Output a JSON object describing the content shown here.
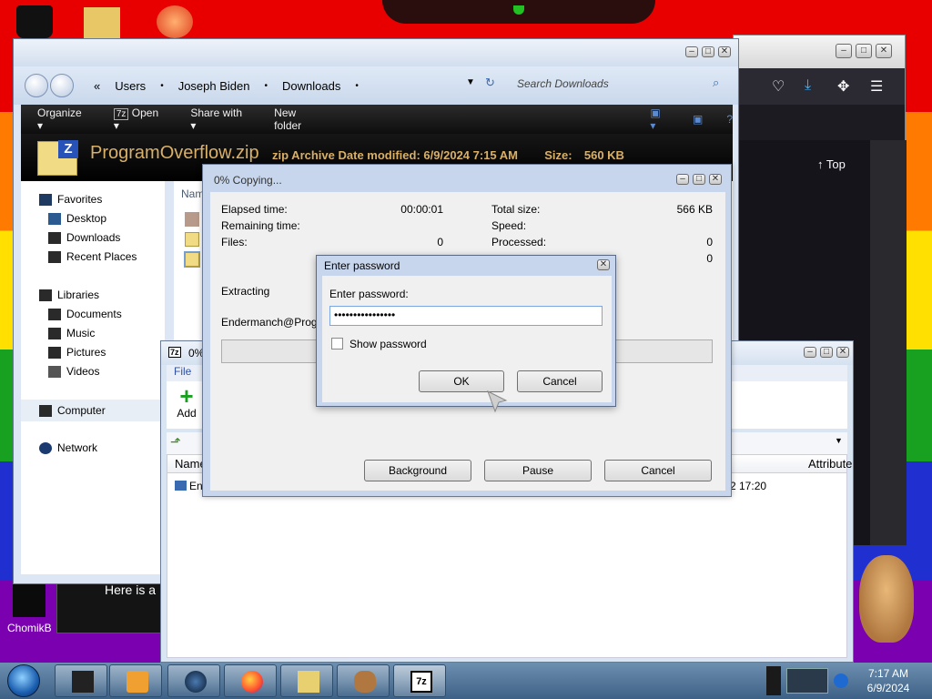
{
  "desktop": {
    "icons": [
      {
        "label": "ChomikB"
      }
    ],
    "note_text": "Here is a"
  },
  "firefox": {
    "top_link": "Top",
    "icons": [
      "pocket-icon",
      "download-icon",
      "extensions-icon",
      "menu-icon"
    ]
  },
  "explorer": {
    "breadcrumb": [
      "Users",
      "Joseph Biden",
      "Downloads"
    ],
    "search_placeholder": "Search Downloads",
    "toolbar": {
      "organize": "Organize",
      "open": "Open",
      "share_with": "Share with",
      "new_folder": "New folder"
    },
    "details": {
      "file_name": "ProgramOverflow.zip",
      "type_label": "zip Archive",
      "date_label": "Date modified:",
      "date_value": "6/9/2024 7:15 AM",
      "size_label": "Size:",
      "size_value": "560 KB"
    },
    "nav": {
      "favorites": "Favorites",
      "desktop": "Desktop",
      "downloads": "Downloads",
      "recent_places": "Recent Places",
      "libraries": "Libraries",
      "documents": "Documents",
      "music": "Music",
      "pictures": "Pictures",
      "videos": "Videos",
      "computer": "Computer",
      "network": "Network"
    },
    "name_header": "Nam"
  },
  "sevenzip": {
    "title": "0%",
    "menu_file": "File",
    "add_label": "Add",
    "col_name": "Name",
    "col_attributes": "Attribute",
    "row_name": "En",
    "row_date": "2 17:20"
  },
  "copying": {
    "title": "0% Copying...",
    "elapsed_label": "Elapsed time:",
    "elapsed_value": "00:00:01",
    "remaining_label": "Remaining time:",
    "files_label": "Files:",
    "files_value": "0",
    "total_size_label": "Total size:",
    "total_size_value": "566 KB",
    "speed_label": "Speed:",
    "processed_label": "Processed:",
    "processed_value": "0",
    "compressed_value": "0",
    "extracting_label": "Extracting",
    "path_text": "Endermanch@Progran",
    "buttons": {
      "background": "Background",
      "pause": "Pause",
      "cancel": "Cancel"
    }
  },
  "password_dialog": {
    "title": "Enter password",
    "prompt": "Enter password:",
    "value": "••••••••••••••••",
    "show_password": "Show password",
    "ok": "OK",
    "cancel": "Cancel"
  },
  "taskbar": {
    "time": "7:17 AM",
    "date": "6/9/2024",
    "buttons": [
      "system-icon",
      "media-player-icon",
      "globe-icon",
      "firefox-icon",
      "explorer-icon",
      "hamster-icon",
      "7zip-icon"
    ]
  }
}
